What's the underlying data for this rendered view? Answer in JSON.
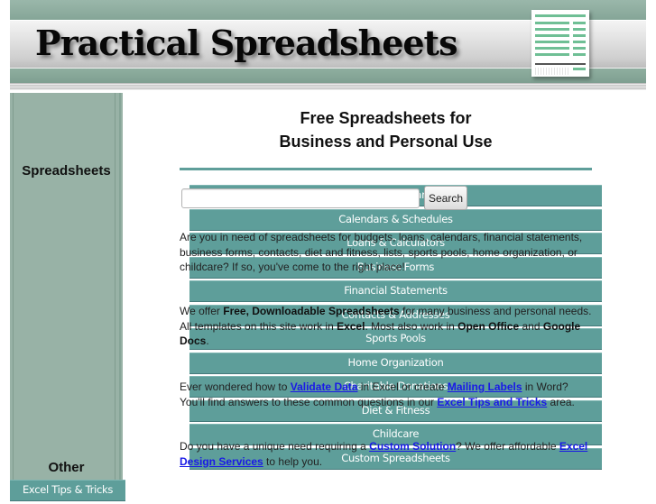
{
  "header": {
    "site_title": "Practical Spreadsheets",
    "logo_icon": "spreadsheet-document-icon"
  },
  "colors": {
    "banner_green": "#8aaa9c",
    "sidebar_bg": "#98b2a6",
    "nav_button": "#5e9e9a",
    "divider": "#5f9e9a",
    "link": "#1a1ae6",
    "icon_rows": "#6fbf95"
  },
  "sidebar": {
    "spreadsheets_heading": "Spreadsheets",
    "items": [
      {
        "label": "Budgets & Finances"
      },
      {
        "label": "Calendars & Schedules"
      },
      {
        "label": "Loans & Calculators"
      },
      {
        "label": "Business Forms"
      },
      {
        "label": "Financial Statements"
      },
      {
        "label": "Contacts & Addresses"
      },
      {
        "label": "Sports Pools"
      },
      {
        "label": "Home Organization"
      },
      {
        "label": "Charitable Donations"
      },
      {
        "label": "Diet & Fitness"
      },
      {
        "label": "Childcare"
      },
      {
        "label": "Custom Spreadsheets"
      }
    ],
    "other_heading": "Other",
    "other_items": [
      {
        "label": "Excel Tips & Tricks"
      }
    ]
  },
  "main": {
    "title_line1": "Free Spreadsheets for",
    "title_line2": "Business and Personal Use",
    "search": {
      "value": "",
      "placeholder": "",
      "button_label": "Search"
    },
    "p1": "Are you in need of spreadsheets for budgets, loans, calendars, financial statements, business forms, contacts, diet and fitness, lists, sports pools, home organization, or childcare? If so, you've come to the right place!",
    "p2": {
      "t1": "We offer ",
      "b1": "Free, Downloadable Spreadsheets",
      "t2": " for many business and personal needs. All templates on this site work in ",
      "b2": "Excel",
      "t3": ". Most also work in ",
      "b3": "Open Office",
      "t4": " and ",
      "b4": "Google Docs",
      "t5": "."
    },
    "p3": {
      "t1": "Ever wondered how to ",
      "link1": "Validate Data",
      "t2": " in Excel or create ",
      "link2": "Mailing Labels",
      "t3": " in Word? You'll find answers to these common questions in our ",
      "link3": "Excel Tips and Tricks",
      "t4": " area."
    },
    "p4": {
      "t1": "Do you have a unique need requiring a ",
      "link1": "Custom Solution",
      "t2": "? We offer affordable ",
      "link2": "Excel Design Services",
      "t3": " to help you."
    }
  }
}
